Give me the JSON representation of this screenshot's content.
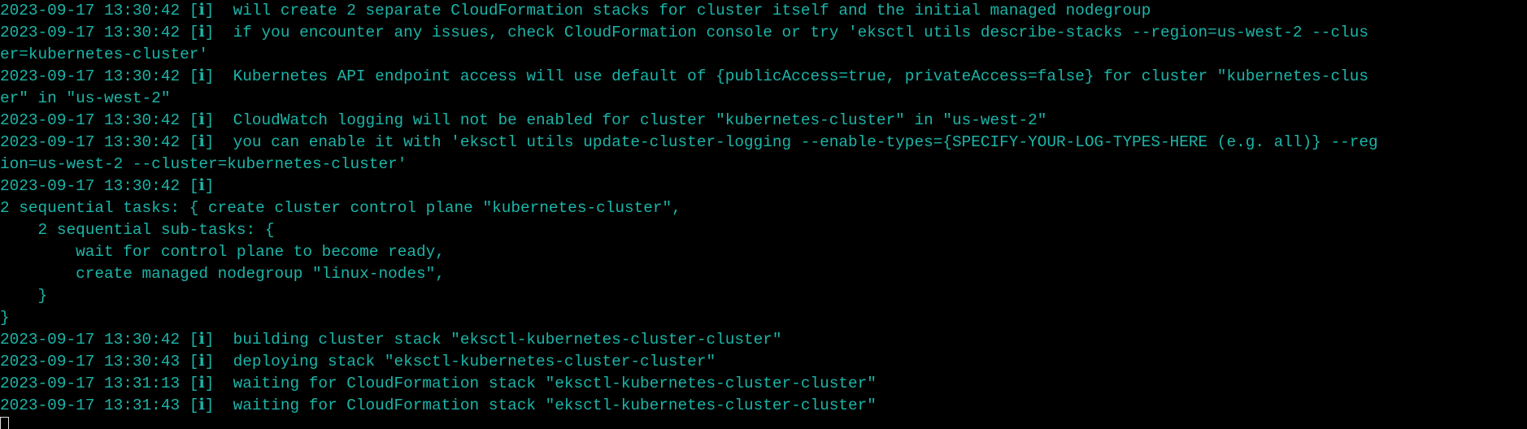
{
  "terminal": {
    "colors": {
      "background": "#000000",
      "text": "#1bb5a8",
      "timestamp": "#d0d0d0",
      "cursor": "#e0e0e0"
    },
    "lines": [
      "2023-09-17 13:30:42 [ℹ]  will create 2 separate CloudFormation stacks for cluster itself and the initial managed nodegroup",
      "2023-09-17 13:30:42 [ℹ]  if you encounter any issues, check CloudFormation console or try 'eksctl utils describe-stacks --region=us-west-2 --clus",
      "er=kubernetes-cluster'",
      "2023-09-17 13:30:42 [ℹ]  Kubernetes API endpoint access will use default of {publicAccess=true, privateAccess=false} for cluster \"kubernetes-clus",
      "er\" in \"us-west-2\"",
      "2023-09-17 13:30:42 [ℹ]  CloudWatch logging will not be enabled for cluster \"kubernetes-cluster\" in \"us-west-2\"",
      "2023-09-17 13:30:42 [ℹ]  you can enable it with 'eksctl utils update-cluster-logging --enable-types={SPECIFY-YOUR-LOG-TYPES-HERE (e.g. all)} --reg",
      "ion=us-west-2 --cluster=kubernetes-cluster'",
      "2023-09-17 13:30:42 [ℹ]",
      "2 sequential tasks: { create cluster control plane \"kubernetes-cluster\",",
      "    2 sequential sub-tasks: {",
      "        wait for control plane to become ready,",
      "        create managed nodegroup \"linux-nodes\",",
      "    }",
      "}",
      "2023-09-17 13:30:42 [ℹ]  building cluster stack \"eksctl-kubernetes-cluster-cluster\"",
      "2023-09-17 13:30:43 [ℹ]  deploying stack \"eksctl-kubernetes-cluster-cluster\"",
      "2023-09-17 13:31:13 [ℹ]  waiting for CloudFormation stack \"eksctl-kubernetes-cluster-cluster\"",
      "2023-09-17 13:31:43 [ℹ]  waiting for CloudFormation stack \"eksctl-kubernetes-cluster-cluster\""
    ]
  }
}
